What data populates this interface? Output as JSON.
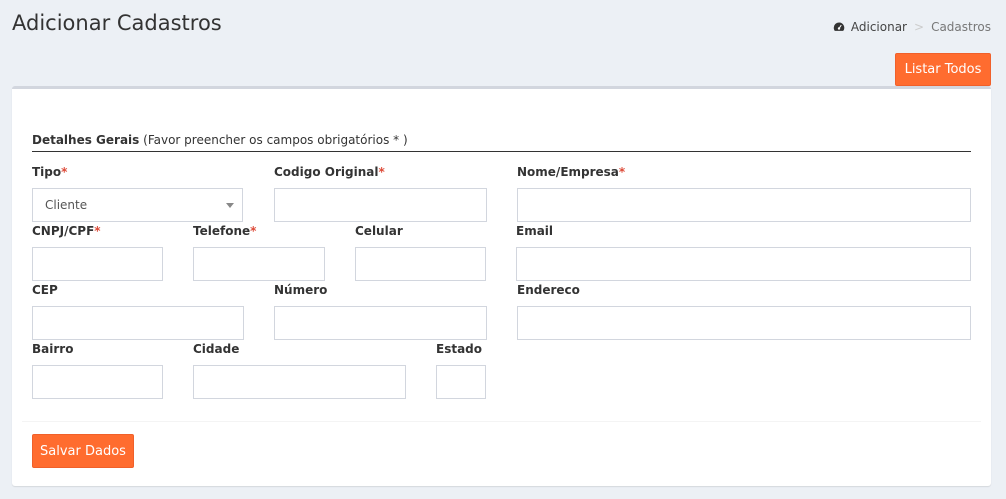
{
  "page": {
    "title": "Adicionar Cadastros"
  },
  "breadcrumb": {
    "icon": "dashboard-icon",
    "home": "Adicionar",
    "separator": ">",
    "current": "Cadastros"
  },
  "toolbar": {
    "list_all_label": "Listar Todos"
  },
  "form": {
    "legend_title": "Detalhes Gerais",
    "legend_note": "(Favor preencher os campos obrigatórios * )",
    "required_marker": "*",
    "fields": {
      "tipo": {
        "label": "Tipo",
        "value": "Cliente",
        "required": true
      },
      "codigo_original": {
        "label": "Codigo Original",
        "value": "",
        "required": true
      },
      "nome_empresa": {
        "label": "Nome/Empresa",
        "value": "",
        "required": true
      },
      "cnpj_cpf": {
        "label": "CNPJ/CPF",
        "value": "",
        "required": true
      },
      "telefone": {
        "label": "Telefone",
        "value": "",
        "required": true
      },
      "celular": {
        "label": "Celular",
        "value": "",
        "required": false
      },
      "email": {
        "label": "Email",
        "value": "",
        "required": false
      },
      "cep": {
        "label": "CEP",
        "value": "",
        "required": false
      },
      "numero": {
        "label": "Número",
        "value": "",
        "required": false
      },
      "endereco": {
        "label": "Endereco",
        "value": "",
        "required": false
      },
      "bairro": {
        "label": "Bairro",
        "value": "",
        "required": false
      },
      "cidade": {
        "label": "Cidade",
        "value": "",
        "required": false
      },
      "estado": {
        "label": "Estado",
        "value": "",
        "required": false
      }
    },
    "save_label": "Salvar Dados"
  },
  "colors": {
    "accent": "#ff6c2f",
    "required": "#dd4b39",
    "background": "#ecf0f5"
  }
}
